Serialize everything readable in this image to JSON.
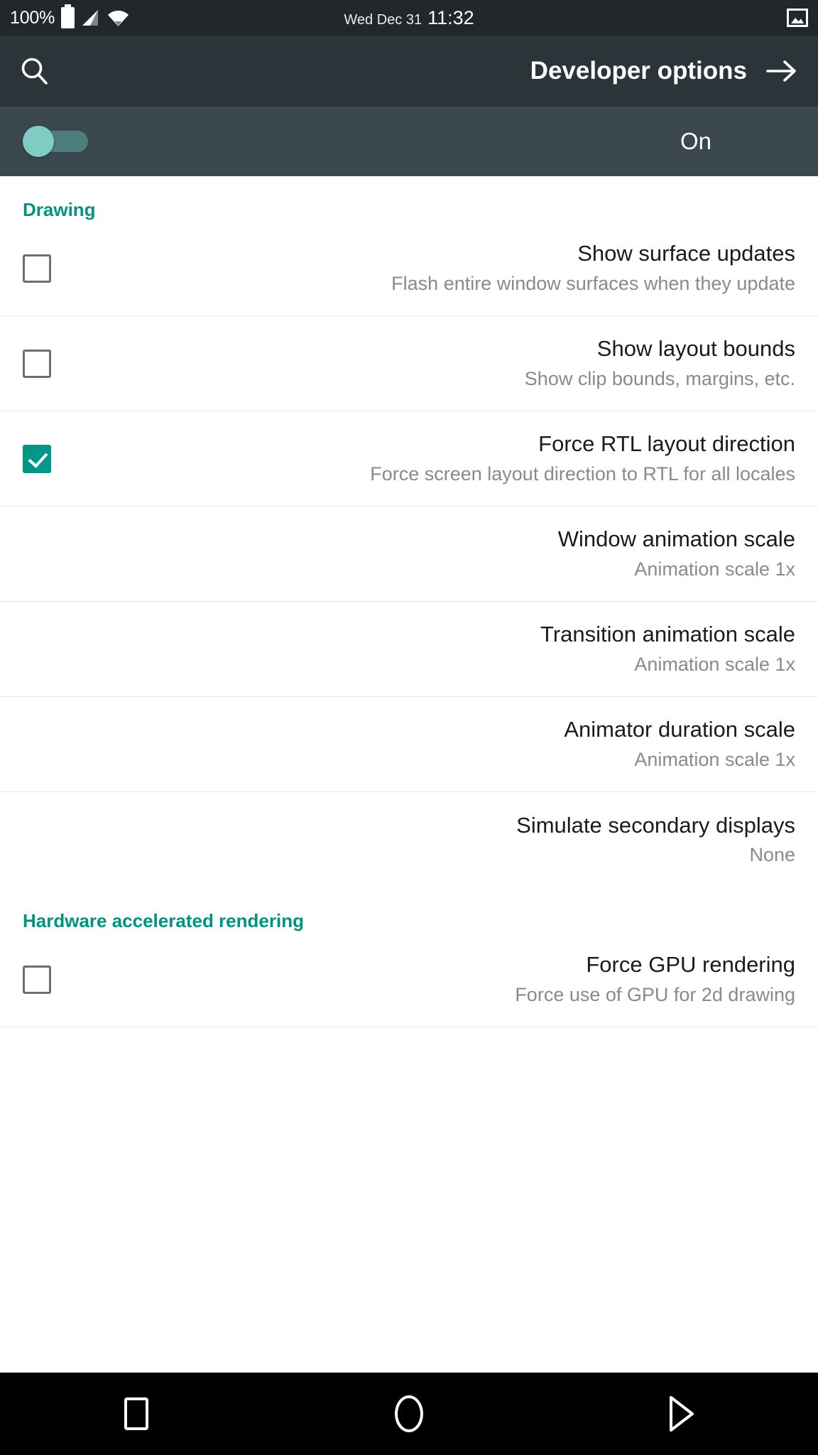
{
  "status_bar": {
    "battery_percent": "100%",
    "date": "Wed Dec 31",
    "time": "11:32",
    "icons": {
      "battery": "battery-full-icon",
      "signal": "cell-signal-icon",
      "wifi": "wifi-icon",
      "screenshot": "screenshot-image-icon"
    }
  },
  "app_bar": {
    "title": "Developer options",
    "search_icon": "search-icon",
    "forward_icon": "arrow-right-icon"
  },
  "master_toggle": {
    "state_label": "On",
    "enabled": true,
    "accent_color": "#80cbc4",
    "track_color": "#4d7d7d"
  },
  "theme": {
    "section_header_color": "#009384",
    "checkbox_checked_color": "#009688",
    "status_bar_bg": "#22272b",
    "app_bar_bg": "#2b3438",
    "toggle_bar_bg": "#3a474c",
    "nav_bar_bg": "#000000"
  },
  "sections": [
    {
      "header": "Drawing",
      "items": [
        {
          "title": "Show surface updates",
          "summary": "Flash entire window surfaces when they update",
          "control": "checkbox",
          "checked": false
        },
        {
          "title": "Show layout bounds",
          "summary": "Show clip bounds, margins, etc.",
          "control": "checkbox",
          "checked": false
        },
        {
          "title": "Force RTL layout direction",
          "summary": "Force screen layout direction to RTL for all locales",
          "control": "checkbox",
          "checked": true
        },
        {
          "title": "Window animation scale",
          "summary": "Animation scale 1x",
          "control": "none",
          "checked": false
        },
        {
          "title": "Transition animation scale",
          "summary": "Animation scale 1x",
          "control": "none",
          "checked": false
        },
        {
          "title": "Animator duration scale",
          "summary": "Animation scale 1x",
          "control": "none",
          "checked": false
        },
        {
          "title": "Simulate secondary displays",
          "summary": "None",
          "control": "none",
          "checked": false
        }
      ]
    },
    {
      "header": "Hardware accelerated rendering",
      "items": [
        {
          "title": "Force GPU rendering",
          "summary": "Force use of GPU for 2d drawing",
          "control": "checkbox",
          "checked": false
        }
      ]
    }
  ],
  "nav_bar": {
    "recents": "recents-square-button",
    "home": "home-circle-button",
    "back": "back-triangle-button"
  }
}
